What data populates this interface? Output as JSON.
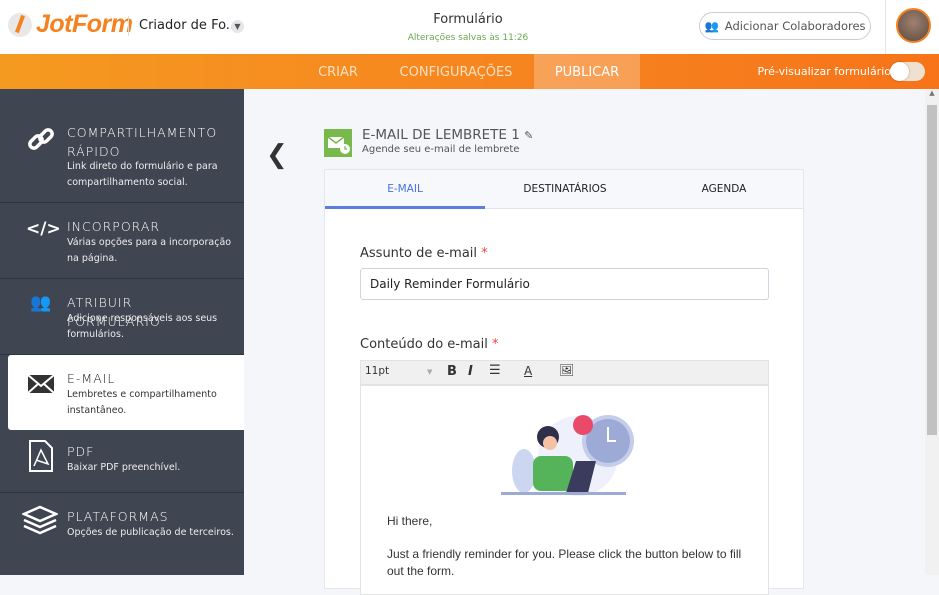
{
  "header": {
    "logo": "JotForm",
    "form_name": "Criador de Fo...",
    "title": "Formulário",
    "saved": "Alterações salvas às 11:26",
    "collab": "Adicionar Colaboradores"
  },
  "nav": {
    "items": [
      "CRIAR",
      "CONFIGURAÇÕES",
      "PUBLICAR"
    ],
    "preview": "Pré-visualizar formulário",
    "preview_on": false
  },
  "sidebar": [
    {
      "title": "COMPARTILHAMENTO RÁPIDO",
      "desc": "Link direto do formulário e para compartilhamento social.",
      "icon": "link-icon"
    },
    {
      "title": "INCORPORAR",
      "desc": "Várias opções para a incorporação na página.",
      "icon": "code-icon"
    },
    {
      "title": "ATRIBUIR FORMULÁRIO",
      "desc": "Adicione responsáveis aos seus formulários.",
      "icon": "users-icon"
    },
    {
      "title": "E-MAIL",
      "desc": "Lembretes e compartilhamento instantâneo.",
      "icon": "envelope-icon"
    },
    {
      "title": "PDF",
      "desc": "Baixar PDF preenchível.",
      "icon": "pdf-icon"
    },
    {
      "title": "PLATAFORMAS",
      "desc": "Opções de publicação de terceiros.",
      "icon": "layers-icon"
    }
  ],
  "reminder": {
    "title": "E-MAIL DE LEMBRETE 1",
    "subtitle": "Agende seu e-mail de lembrete"
  },
  "tabs": [
    "E-MAIL",
    "DESTINATÁRIOS",
    "AGENDA"
  ],
  "form": {
    "subject_label": "Assunto de e-mail",
    "required": "*",
    "subject_value": "Daily Reminder Formulário",
    "content_label": "Conteúdo do e-mail",
    "font_size": "11pt",
    "greeting": "Hi there,",
    "body": "Just a friendly reminder for you. Please click the button below to fill out the form."
  }
}
